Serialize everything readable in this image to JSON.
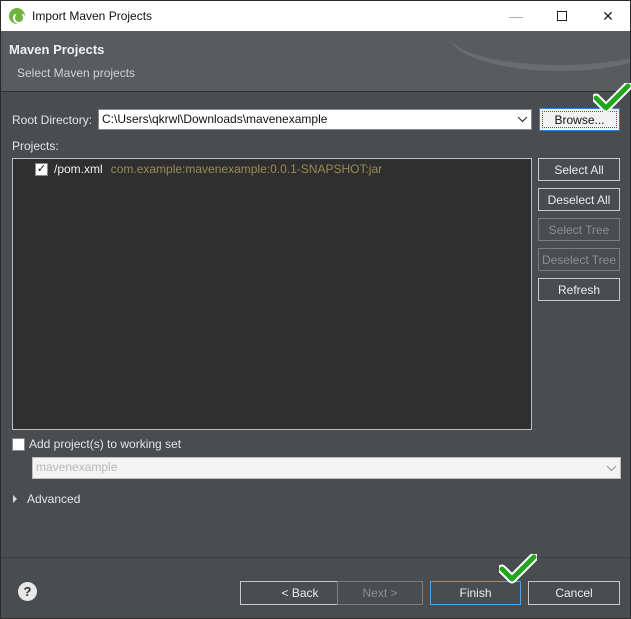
{
  "window": {
    "title": "Import Maven Projects",
    "minimize": "—",
    "close": "✕"
  },
  "header": {
    "title": "Maven Projects",
    "subtitle": "Select Maven projects"
  },
  "root": {
    "label": "Root Directory:",
    "value": "C:\\Users\\qkrwl\\Downloads\\mavenexample",
    "browse_label": "Browse..."
  },
  "projects": {
    "label": "Projects:",
    "items": [
      {
        "name": "/pom.xml",
        "coordinates": "com.example:mavenexample:0.0.1-SNAPSHOT:jar",
        "checked": true
      }
    ]
  },
  "side_buttons": {
    "select_all": "Select All",
    "deselect_all": "Deselect All",
    "select_tree": "Select Tree",
    "deselect_tree": "Deselect Tree",
    "refresh": "Refresh"
  },
  "working_set": {
    "label": "Add project(s) to working set",
    "value": "mavenexample",
    "checked": false
  },
  "advanced": {
    "label": "Advanced"
  },
  "footer": {
    "help": "?",
    "back": "< Back",
    "next": "Next >",
    "finish": "Finish",
    "cancel": "Cancel"
  },
  "colors": {
    "accent_check": "#22a61f",
    "focus_border": "#4da3e8",
    "coord_text": "#9a8a55"
  },
  "icons": {
    "app": "spring-leaf-icon",
    "annotation": "green-checkmark-icon"
  }
}
